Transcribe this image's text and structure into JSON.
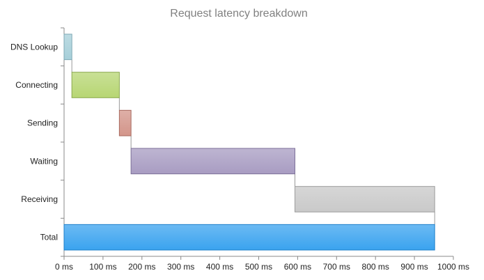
{
  "chart_data": {
    "type": "bar",
    "orientation": "horizontal",
    "style": "waterfall",
    "title": "Request latency breakdown",
    "xlabel": "",
    "ylabel": "",
    "xlim": [
      0,
      1000
    ],
    "unit": "ms",
    "x_ticks": [
      "0 ms",
      "100 ms",
      "200 ms",
      "300 ms",
      "400 ms",
      "500 ms",
      "600 ms",
      "700 ms",
      "800 ms",
      "900 ms",
      "1000 ms"
    ],
    "grid": false,
    "legend": "none",
    "categories": [
      "DNS Lookup",
      "Connecting",
      "Sending",
      "Waiting",
      "Receiving",
      "Total"
    ],
    "bars": [
      {
        "label": "DNS Lookup",
        "start": 0,
        "end": 20,
        "color": "#a6cfd9",
        "stroke": "#7fa9b5"
      },
      {
        "label": "Connecting",
        "start": 20,
        "end": 142,
        "color": "#b7d673",
        "stroke": "#8aa84e"
      },
      {
        "label": "Sending",
        "start": 142,
        "end": 172,
        "color": "#d3958a",
        "stroke": "#a86a5f"
      },
      {
        "label": "Waiting",
        "start": 172,
        "end": 593,
        "color": "#a89cc2",
        "stroke": "#7d7199"
      },
      {
        "label": "Receiving",
        "start": 593,
        "end": 952,
        "color": "#c9c9c9",
        "stroke": "#9b9b9b"
      },
      {
        "label": "Total",
        "start": 0,
        "end": 952,
        "color": "#3aa3ef",
        "stroke": "#1f7fc9"
      }
    ]
  }
}
